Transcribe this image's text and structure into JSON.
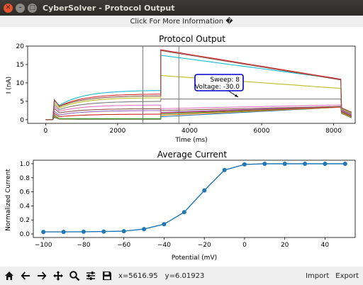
{
  "window": {
    "title": "CyberSolver - Protocol Output"
  },
  "info_bar": {
    "text": "Click For More Information �"
  },
  "toolbar": {
    "icons": [
      "home-icon",
      "back-arrow-icon",
      "forward-arrow-icon",
      "pan-icon",
      "zoom-icon",
      "configure-subplots-icon",
      "save-icon"
    ],
    "x_readout": "x=5616.95",
    "y_readout": "y=6.01923",
    "import_label": "Import",
    "export_label": "Export"
  },
  "annotation": {
    "line1": "Sweep: 8",
    "line2": "Voltage: -30.0"
  },
  "chart_data": [
    {
      "type": "line",
      "title": "Protocol Output",
      "xlabel": "Time (ms)",
      "ylabel": "I (nA)",
      "xlim": [
        -500,
        8600
      ],
      "ylim": [
        -1,
        20
      ],
      "xticks": [
        0,
        2000,
        4000,
        6000,
        8000
      ],
      "yticks": [
        0,
        5,
        10,
        15,
        20
      ],
      "grid": false,
      "legend": "none",
      "cursor_lines_x": [
        2700,
        3700
      ],
      "segments": {
        "prepulse": [
          200,
          3200
        ],
        "test_pulse": [
          3200,
          8200
        ],
        "tail_end": 8500
      },
      "series": [
        {
          "color": "#1f77b4",
          "hold_peak": 0.2,
          "hold_end": 0.1,
          "test_start": 0.8,
          "test_end": 3.4,
          "tail": 0.5
        },
        {
          "color": "#ff7f0e",
          "hold_peak": 0.3,
          "hold_end": 0.2,
          "test_start": 1.2,
          "test_end": 3.4,
          "tail": 0.6
        },
        {
          "color": "#2ca02c",
          "hold_peak": 0.5,
          "hold_end": 0.3,
          "test_start": 1.5,
          "test_end": 3.5,
          "tail": 0.8
        },
        {
          "color": "#d62728",
          "hold_peak": 1.0,
          "hold_end": 1.5,
          "test_start": 1.8,
          "test_end": 3.5,
          "tail": 1.0
        },
        {
          "color": "#9467bd",
          "hold_peak": 1.5,
          "hold_end": 2.5,
          "test_start": 2.0,
          "test_end": 3.6,
          "tail": 1.2
        },
        {
          "color": "#8c564b",
          "hold_peak": 2.5,
          "hold_end": 3.0,
          "test_start": 2.5,
          "test_end": 3.6,
          "tail": 1.4
        },
        {
          "color": "#e377c2",
          "hold_peak": 3.0,
          "hold_end": 4.0,
          "test_start": 3.0,
          "test_end": 4.0,
          "tail": 1.5
        },
        {
          "color": "#7f7f7f",
          "hold_peak": 3.5,
          "hold_end": 5.0,
          "test_start": 5.6,
          "test_end": 5.6,
          "tail": 1.6
        },
        {
          "color": "#bcbd22",
          "hold_peak": 4.0,
          "hold_end": 6.0,
          "test_start": 12.0,
          "test_end": 8.5,
          "tail": 1.8
        },
        {
          "color": "#17becf",
          "hold_peak": 4.5,
          "hold_end": 8.0,
          "test_start": 17.5,
          "test_end": 11.0,
          "tail": 2.0
        },
        {
          "color": "#d62728",
          "hold_peak": 4.5,
          "hold_end": 7.0,
          "test_start": 19.0,
          "test_end": 11.0,
          "tail": 2.0
        },
        {
          "color": "#8c564b",
          "hold_peak": 4.5,
          "hold_end": 6.5,
          "test_start": 18.8,
          "test_end": 10.8,
          "tail": 2.0
        }
      ]
    },
    {
      "type": "line",
      "title": "Average Current",
      "xlabel": "Potential (mV)",
      "ylabel": "Normalized Current",
      "xlim": [
        -105,
        55
      ],
      "ylim": [
        -0.05,
        1.05
      ],
      "xticks": [
        -100,
        -80,
        -60,
        -40,
        -20,
        0,
        20,
        40
      ],
      "yticks": [
        0.0,
        0.2,
        0.4,
        0.6,
        0.8,
        1.0
      ],
      "grid": false,
      "legend": "none",
      "x": [
        -100,
        -90,
        -80,
        -70,
        -60,
        -50,
        -40,
        -30,
        -20,
        -10,
        0,
        10,
        20,
        30,
        40,
        50
      ],
      "y": [
        0.03,
        0.03,
        0.032,
        0.035,
        0.04,
        0.07,
        0.14,
        0.31,
        0.62,
        0.91,
        0.99,
        1.0,
        1.0,
        1.0,
        1.0,
        1.0
      ],
      "color": "#1f77b4"
    }
  ]
}
